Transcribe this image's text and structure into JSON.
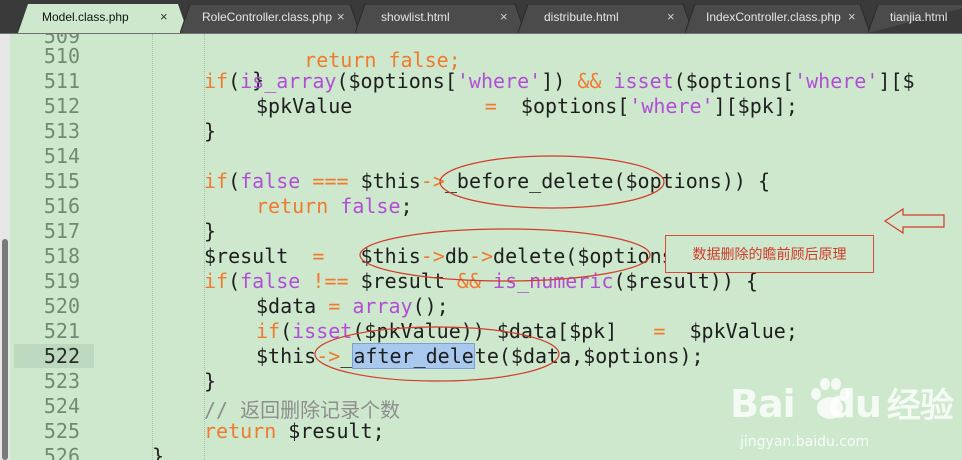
{
  "tabs": [
    {
      "label": "Model.class.php",
      "active": true,
      "close": "×"
    },
    {
      "label": "RoleController.class.php",
      "active": false,
      "close": "×"
    },
    {
      "label": "showlist.html",
      "active": false,
      "close": "×"
    },
    {
      "label": "distribute.html",
      "active": false,
      "close": "×"
    },
    {
      "label": "IndexController.class.php",
      "active": false,
      "close": "×"
    },
    {
      "label": "tianjia.html",
      "active": false,
      "close": ""
    }
  ],
  "editor": {
    "current_line": "522",
    "lines": [
      {
        "n": "509"
      },
      {
        "n": "510"
      },
      {
        "n": "511"
      },
      {
        "n": "512"
      },
      {
        "n": "513"
      },
      {
        "n": "514"
      },
      {
        "n": "515"
      },
      {
        "n": "516"
      },
      {
        "n": "517"
      },
      {
        "n": "518"
      },
      {
        "n": "519"
      },
      {
        "n": "520"
      },
      {
        "n": "521"
      },
      {
        "n": "522"
      },
      {
        "n": "523"
      },
      {
        "n": "524"
      },
      {
        "n": "525"
      },
      {
        "n": "526"
      }
    ],
    "code": {
      "l509": [
        "return false;"
      ],
      "l510": [
        "}"
      ],
      "l511": [
        "if",
        "(",
        "is_array",
        "($options[",
        "'where'",
        "]) ",
        "&&",
        " ",
        "isset",
        "($options[",
        "'where'",
        "][$"
      ],
      "l512": [
        "$pkValue",
        "           ",
        "=",
        "  $options[",
        "'where'",
        "][$pk];"
      ],
      "l513": [
        "}"
      ],
      "l515": [
        "if",
        "(",
        "false",
        " ",
        "===",
        " $this",
        "->",
        "_before_delete($options)) {"
      ],
      "l516": [
        "return",
        " ",
        "false",
        ";"
      ],
      "l517": [
        "}"
      ],
      "l518": [
        "$result  ",
        "=",
        "   $this",
        "->",
        "db",
        "->",
        "delete($options);"
      ],
      "l519": [
        "if",
        "(",
        "false",
        " ",
        "!==",
        " $result ",
        "&&",
        " ",
        "is_numeric",
        "($result)) {"
      ],
      "l520": [
        "$data ",
        "=",
        " ",
        "array",
        "();"
      ],
      "l521": [
        "if",
        "(",
        "isset",
        "($pkValue)) $data[$pk]   ",
        "=",
        "  $pkValue;"
      ],
      "l522": [
        "$this",
        "->",
        "_",
        "after_dele",
        "te($data,$options);"
      ],
      "l523": [
        "}"
      ],
      "l524": [
        "// 返回删除记录个数"
      ],
      "l525": [
        "return",
        " $result;"
      ],
      "l526": [
        "}"
      ]
    }
  },
  "annotation": {
    "note": "数据删除的瞻前顾后原理",
    "color": "#d23b2a"
  },
  "watermark": {
    "brand": "Bai",
    "brand2": "du",
    "brand3": "经验",
    "url": "jingyan.baidu.com"
  },
  "colors": {
    "background": "#cde8cd",
    "keyword": "#b24ed6",
    "operator": "#f07a2f",
    "comment": "#8e8e8e"
  }
}
